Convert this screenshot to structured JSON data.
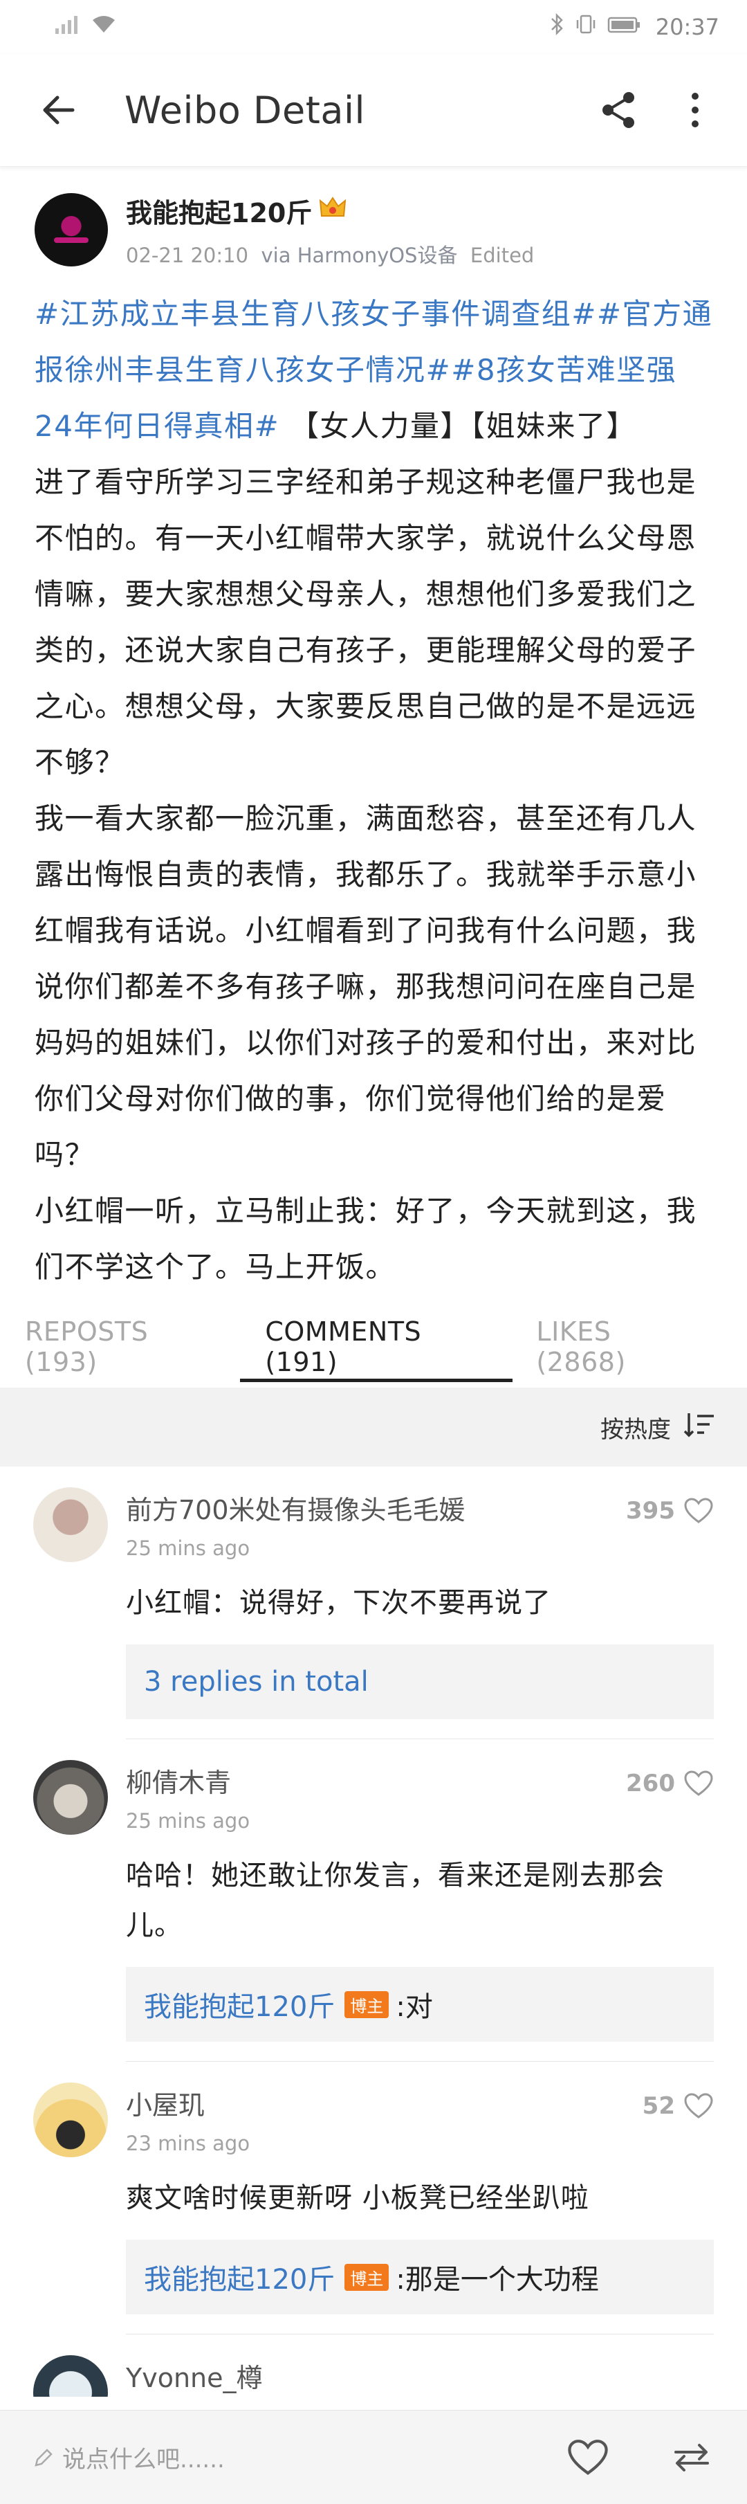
{
  "status_bar": {
    "time": "20:37"
  },
  "app_bar": {
    "title": "Weibo Detail"
  },
  "post": {
    "author": "我能抱起120斤",
    "date": "02-21 20:10",
    "via": "via HarmonyOS设备",
    "edited": "Edited",
    "tags": [
      "#江苏成立丰县生育八孩女子事件调查组#",
      "#官方通报徐州丰县生育八孩女子情况#",
      "#8孩女苦难坚强24年何日得真相#"
    ],
    "topic_suffix": " 【女人力量】【姐妹来了】",
    "paragraphs": [
      "进了看守所学习三字经和弟子规这种老僵尸我也是不怕的。有一天小红帽带大家学，就说什么父母恩情嘛，要大家想想父母亲人，想想他们多爱我们之类的，还说大家自己有孩子，更能理解父母的爱子之心。想想父母，大家要反思自己做的是不是远远不够？",
      "我一看大家都一脸沉重，满面愁容，甚至还有几人露出悔恨自责的表情，我都乐了。我就举手示意小红帽我有话说。小红帽看到了问我有什么问题，我说你们都差不多有孩子嘛，那我想问问在座自己是妈妈的姐妹们，以你们对孩子的爱和付出，来对比你们父母对你们做的事，你们觉得他们给的是爱吗？",
      "小红帽一听，立马制止我：好了，今天就到这，我们不学这个了。马上开饭。"
    ]
  },
  "tabs": [
    {
      "label": "REPOSTS (193)"
    },
    {
      "label": "COMMENTS (191)"
    },
    {
      "label": "LIKES (2868)"
    }
  ],
  "sort": {
    "label": "按热度"
  },
  "comments": [
    {
      "name": "前方700米处有摄像头毛毛媛",
      "time": "25 mins ago",
      "likes": "395",
      "text": "小红帽：说得好，下次不要再说了",
      "reply_summary": "3 replies in total"
    },
    {
      "name": "柳倩木青",
      "time": "25 mins ago",
      "likes": "260",
      "text": "哈哈！她还敢让你发言，看来还是刚去那会儿。",
      "reply_author": "我能抱起120斤",
      "reply_badge": "博主",
      "reply_text": ":对"
    },
    {
      "name": "小屋玑",
      "time": "23 mins ago",
      "likes": "52",
      "text": "爽文啥时候更新呀 小板凳已经坐趴啦",
      "reply_author": "我能抱起120斤",
      "reply_badge": "博主",
      "reply_text": ":那是一个大功程"
    },
    {
      "name": "Yvonne_樽"
    }
  ],
  "bottom_bar": {
    "placeholder": "说点什么吧......"
  }
}
